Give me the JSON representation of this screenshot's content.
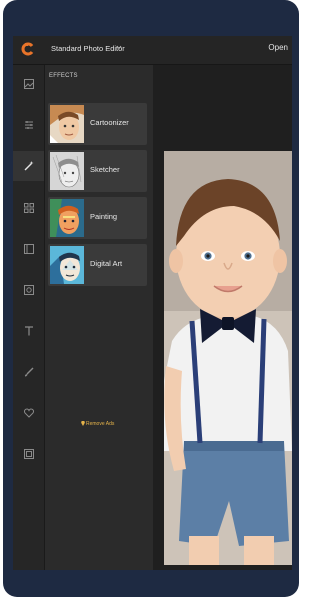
{
  "app": {
    "title": "Standard Photo Editor",
    "open_label": "Open"
  },
  "rail": {
    "items": [
      {
        "icon": "image-icon",
        "active": false
      },
      {
        "icon": "sliders-icon",
        "active": false
      },
      {
        "icon": "magic-wand-icon",
        "active": true
      },
      {
        "icon": "grid-icon",
        "active": false
      },
      {
        "icon": "frame-icon",
        "active": false
      },
      {
        "icon": "focus-icon",
        "active": false
      },
      {
        "icon": "text-icon",
        "active": false
      },
      {
        "icon": "brush-icon",
        "active": false
      },
      {
        "icon": "heart-icon",
        "active": false
      },
      {
        "icon": "border-icon",
        "active": false
      }
    ]
  },
  "panel": {
    "title": "EFFECTS",
    "effects": [
      {
        "label": "Cartoonizer"
      },
      {
        "label": "Sketcher"
      },
      {
        "label": "Painting"
      },
      {
        "label": "Digital Art"
      }
    ],
    "remove_ads": "Remove Ads"
  },
  "colors": {
    "accent": "#e4b24a",
    "frame": "#1e2a42",
    "logo": "#e8742a"
  }
}
